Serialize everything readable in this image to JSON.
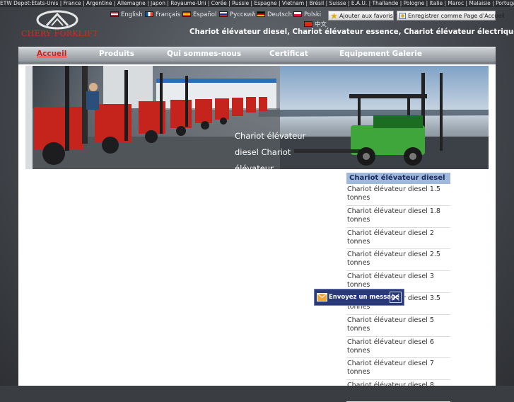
{
  "depots": "ETW Depot:États-Unis | France | Argentine | Allemagne | Japon | Royaume-Uni | Corée | Russie | Espagne | Vietnam | Brésil | Suisse | E.A.U. | Thaïlande | Pologne | Italie | Maroc | Malaisie | Portugal",
  "logo": {
    "text": "CHERY FORKLIFT"
  },
  "languages": [
    {
      "label": "English",
      "flag": "us"
    },
    {
      "label": "Français",
      "flag": "fr"
    },
    {
      "label": "Español",
      "flag": "es"
    },
    {
      "label": "Русский",
      "flag": "ru"
    },
    {
      "label": "Deutsch",
      "flag": "de"
    },
    {
      "label": "Polski",
      "flag": "pl"
    },
    {
      "label": "中文",
      "flag": "cn"
    }
  ],
  "favorites": {
    "add": "Ajouter aux favoris",
    "home": "Enregistrer comme Page d'Accueil"
  },
  "tagline": "Chariot élévateur diesel, Chariot élévateur essence, Chariot élévateur électrique",
  "nav": [
    {
      "label": "Accueil",
      "active": true
    },
    {
      "label": "Produits"
    },
    {
      "label": "Qui sommes-nous"
    },
    {
      "label": "Certificat"
    },
    {
      "label": "Equipement Galerie"
    }
  ],
  "banner_caption": "Chariot élévateur diesel Chariot élévateur",
  "sidebar": {
    "heading": "Chariot élévateur diesel",
    "items": [
      "Chariot élévateur diesel 1.5 tonnes",
      "Chariot élévateur diesel 1.8 tonnes",
      "Chariot élévateur diesel 2 tonnes",
      "Chariot élévateur diesel 2.5 tonnes",
      "Chariot élévateur diesel 3 tonnes",
      "Chariot élévateur diesel 3.5 tonnes",
      "Chariot élévateur diesel 5 tonnes",
      "Chariot élévateur diesel 6 tonnes",
      "Chariot élévateur diesel 7 tonnes",
      "Chariot élévateur diesel 8"
    ]
  },
  "message": {
    "label": "Envoyez un message"
  },
  "colors": {
    "accent_red": "#d4201a",
    "sidebar_head": "#9fb8db",
    "msg_bg": "#2a3a78"
  }
}
